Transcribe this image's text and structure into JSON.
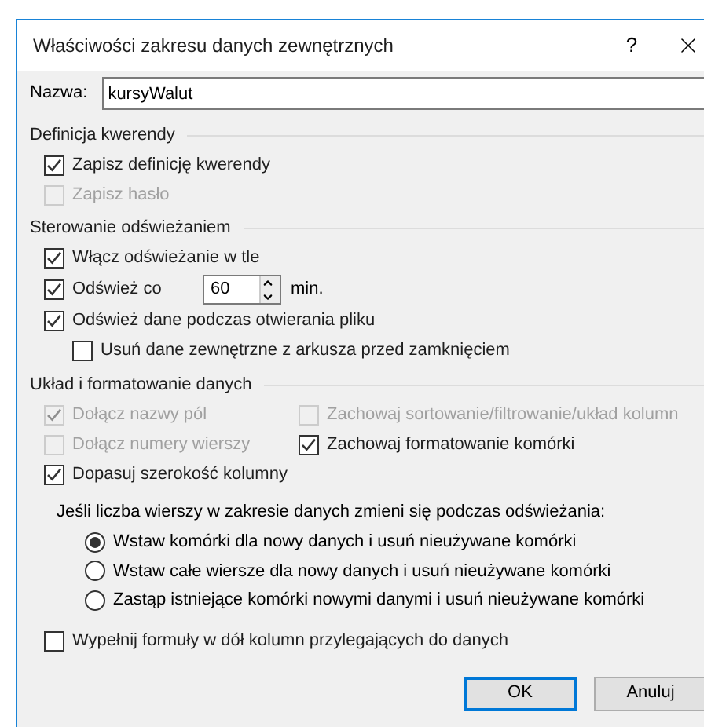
{
  "window": {
    "title": "Właściwości zakresu danych zewnętrznych",
    "help": "?"
  },
  "name_field": {
    "label": "Nazwa:",
    "value": "kursyWalut"
  },
  "query_definition": {
    "title": "Definicja kwerendy",
    "options": [
      {
        "label": "Zapisz definicję kwerendy",
        "checked": true,
        "disabled": false
      },
      {
        "label": "Zapisz hasło",
        "checked": false,
        "disabled": true
      }
    ]
  },
  "refresh_control": {
    "title": "Sterowanie odświeżaniem",
    "options": [
      {
        "kind": "checkbox",
        "label": "Włącz odświeżanie w tle",
        "checked": true,
        "disabled": false
      },
      {
        "kind": "interval",
        "label": "Odśwież co",
        "checked": true,
        "disabled": false,
        "value": "60",
        "unit": "min."
      },
      {
        "kind": "checkbox",
        "label": "Odśwież dane podczas otwierania pliku",
        "checked": true,
        "disabled": false,
        "children": [
          {
            "kind": "checkbox",
            "label": "Usuń dane zewnętrzne z arkusza przed zamknięciem",
            "checked": false,
            "disabled": false
          }
        ]
      }
    ]
  },
  "data_layout": {
    "title": "Układ i formatowanie danych",
    "left_column": [
      {
        "label": "Dołącz nazwy pól",
        "checked": true,
        "disabled": true
      },
      {
        "label": "Dołącz numery wierszy",
        "checked": false,
        "disabled": true
      },
      {
        "label": "Dopasuj szerokość kolumny",
        "checked": true,
        "disabled": false
      }
    ],
    "right_column": [
      {
        "label": "Zachowaj sortowanie/filtrowanie/układ kolumn",
        "checked": false,
        "disabled": true
      },
      {
        "label": "Zachowaj formatowanie komórki",
        "checked": true,
        "disabled": false
      }
    ],
    "question": "Jeśli liczba wierszy w zakresie danych zmieni się podczas odświeżania:",
    "radios": [
      {
        "label": "Wstaw komórki dla nowy danych i usuń nieużywane komórki",
        "selected": true
      },
      {
        "label": "Wstaw całe wiersze dla nowy danych i usuń nieużywane komórki",
        "selected": false
      },
      {
        "label": "Zastąp istniejące komórki nowymi danymi i usuń nieużywane komórki",
        "selected": false
      }
    ],
    "fill_formulas": {
      "label": "Wypełnij formuły w dół kolumn przylegających do danych",
      "checked": false,
      "disabled": false
    }
  },
  "buttons": [
    {
      "label": "OK",
      "default": true
    },
    {
      "label": "Anuluj",
      "default": false
    }
  ]
}
